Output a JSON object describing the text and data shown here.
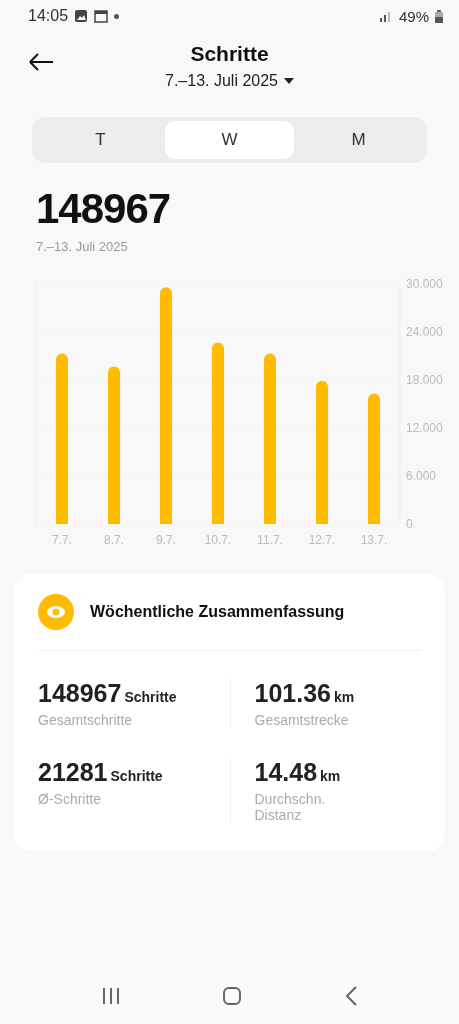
{
  "status_bar": {
    "time": "14:05",
    "battery": "49%"
  },
  "header": {
    "title": "Schritte",
    "date_range": "7.–13. Juli 2025"
  },
  "tabs": [
    {
      "label": "T",
      "selected": false
    },
    {
      "label": "W",
      "selected": true
    },
    {
      "label": "M",
      "selected": false
    }
  ],
  "total": {
    "value": "148967",
    "date": "7.–13. Juli 2025"
  },
  "chart_data": {
    "type": "bar",
    "categories": [
      "7.7.",
      "8.7.",
      "9.7.",
      "10.7.",
      "11.7.",
      "12.7.",
      "13.7."
    ],
    "series": [
      {
        "color": "#ffbb00",
        "values": [
          21.3,
          19.7,
          29.6,
          22.7,
          21.3,
          17.9,
          16.3
        ]
      }
    ],
    "ylim": [
      0,
      30
    ],
    "yticks": [
      {
        "value": 0,
        "label": "0"
      },
      {
        "value": 6,
        "label": "6.000"
      },
      {
        "value": 12,
        "label": "12.000"
      },
      {
        "value": 18,
        "label": "18.000"
      },
      {
        "value": 24,
        "label": "24.000"
      },
      {
        "value": 30,
        "label": "30.000"
      }
    ]
  },
  "summary": {
    "title": "Wöchentliche Zusammenfassung",
    "stats": [
      {
        "value": "148967",
        "unit": "Schritte",
        "label": "Gesamtschritte"
      },
      {
        "value": "101.36",
        "unit": "km",
        "label": "Gesamtstrecke"
      },
      {
        "value": "21281",
        "unit": "Schritte",
        "label": "Ø-Schritte"
      },
      {
        "value": "14.48",
        "unit": "km",
        "label": "Durchschn. Distanz"
      }
    ]
  }
}
